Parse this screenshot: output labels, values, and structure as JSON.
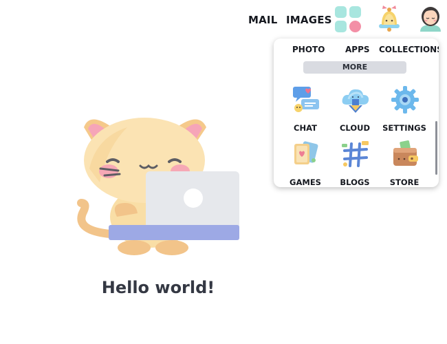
{
  "nav": {
    "mail": "MAIL",
    "images": "IMAGES"
  },
  "icons": {
    "apps": "apps-grid-icon",
    "notifications": "bell-icon",
    "profile": "avatar"
  },
  "colors": {
    "grid_teal": "#a8e6df",
    "grid_pink": "#f38fa6",
    "panel_bg": "#ffffff",
    "more_bg": "#d9dbe1"
  },
  "apps_panel": {
    "top_row": [
      "PHOTO",
      "APPS",
      "COLLECTIONS"
    ],
    "more_label": "MORE",
    "items": [
      {
        "label": "CHAT",
        "icon": "chat-icon"
      },
      {
        "label": "CLOUD",
        "icon": "cloud-icon"
      },
      {
        "label": "SETTINGS",
        "icon": "gear-icon"
      },
      {
        "label": "GAMES",
        "icon": "games-icon"
      },
      {
        "label": "BLOGS",
        "icon": "blogs-icon"
      },
      {
        "label": "STORE",
        "icon": "store-icon"
      }
    ]
  },
  "main": {
    "greeting": "Hello world!",
    "illustration": "cat-with-laptop-illustration"
  }
}
